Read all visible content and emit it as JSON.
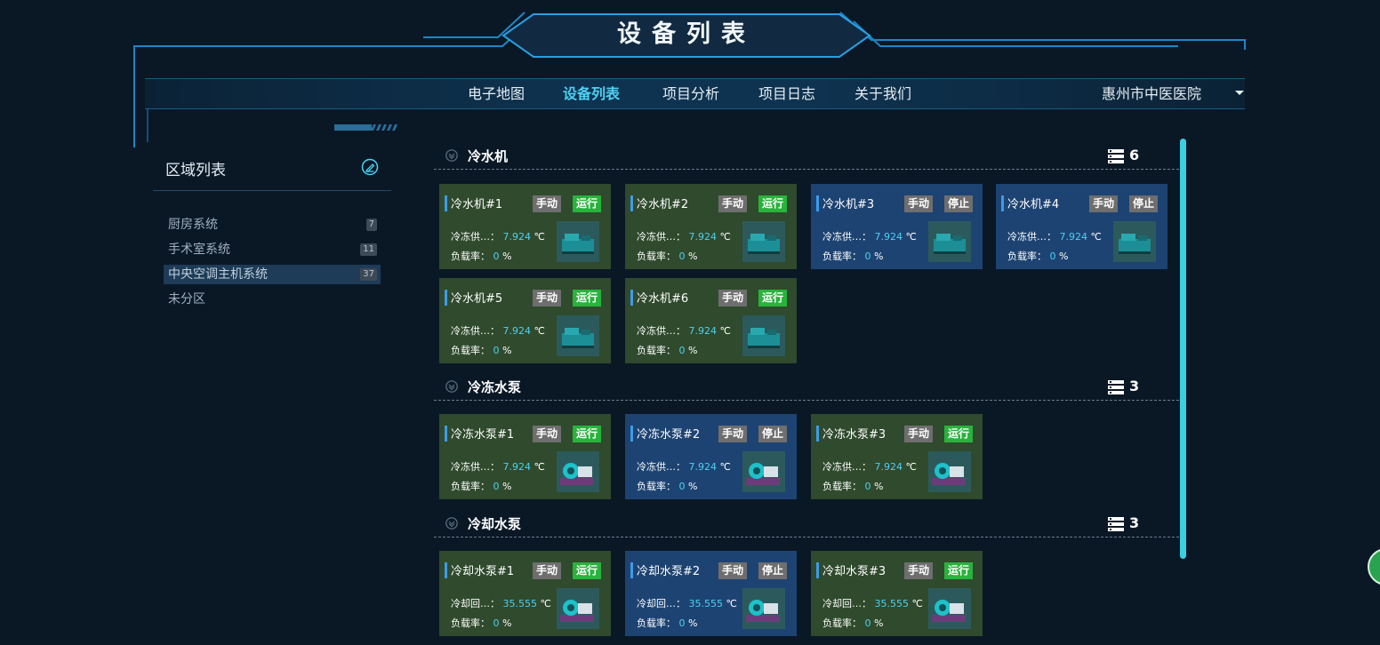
{
  "header": {
    "title": "设备列表"
  },
  "nav": {
    "items": [
      {
        "label": "电子地图",
        "active": false
      },
      {
        "label": "设备列表",
        "active": true
      },
      {
        "label": "项目分析",
        "active": false
      },
      {
        "label": "项目日志",
        "active": false
      },
      {
        "label": "关于我们",
        "active": false
      }
    ],
    "hospital": "惠州市中医医院"
  },
  "sidebar": {
    "title": "区域列表",
    "items": [
      {
        "label": "厨房系统",
        "count": "7",
        "selected": false
      },
      {
        "label": "手术室系统",
        "count": "11",
        "selected": false
      },
      {
        "label": "中央空调主机系统",
        "count": "37",
        "selected": true
      },
      {
        "label": "未分区",
        "count": "",
        "selected": false
      }
    ]
  },
  "sections": [
    {
      "title": "冷水机",
      "count": "6",
      "devices": [
        {
          "name": "冷水机#1",
          "mode": "手动",
          "status": "运行",
          "line1_label": "冷冻供…：",
          "line1_value": "7.924",
          "line1_unit": "℃",
          "line2_label": "负载率：",
          "line2_value": "0",
          "line2_unit": "%",
          "icon": "chiller-icon"
        },
        {
          "name": "冷水机#2",
          "mode": "手动",
          "status": "运行",
          "line1_label": "冷冻供…：",
          "line1_value": "7.924",
          "line1_unit": "℃",
          "line2_label": "负载率：",
          "line2_value": "0",
          "line2_unit": "%",
          "icon": "chiller-icon"
        },
        {
          "name": "冷水机#3",
          "mode": "手动",
          "status": "停止",
          "line1_label": "冷冻供…：",
          "line1_value": "7.924",
          "line1_unit": "℃",
          "line2_label": "负载率：",
          "line2_value": "0",
          "line2_unit": "%",
          "icon": "chiller-icon"
        },
        {
          "name": "冷水机#4",
          "mode": "手动",
          "status": "停止",
          "line1_label": "冷冻供…：",
          "line1_value": "7.924",
          "line1_unit": "℃",
          "line2_label": "负载率：",
          "line2_value": "0",
          "line2_unit": "%",
          "icon": "chiller-icon"
        },
        {
          "name": "冷水机#5",
          "mode": "手动",
          "status": "运行",
          "line1_label": "冷冻供…：",
          "line1_value": "7.924",
          "line1_unit": "℃",
          "line2_label": "负载率：",
          "line2_value": "0",
          "line2_unit": "%",
          "icon": "chiller-icon"
        },
        {
          "name": "冷水机#6",
          "mode": "手动",
          "status": "运行",
          "line1_label": "冷冻供…：",
          "line1_value": "7.924",
          "line1_unit": "℃",
          "line2_label": "负载率：",
          "line2_value": "0",
          "line2_unit": "%",
          "icon": "chiller-icon"
        }
      ]
    },
    {
      "title": "冷冻水泵",
      "count": "3",
      "devices": [
        {
          "name": "冷冻水泵#1",
          "mode": "手动",
          "status": "运行",
          "line1_label": "冷冻供…：",
          "line1_value": "7.924",
          "line1_unit": "℃",
          "line2_label": "负载率：",
          "line2_value": "0",
          "line2_unit": "%",
          "icon": "pump-icon"
        },
        {
          "name": "冷冻水泵#2",
          "mode": "手动",
          "status": "停止",
          "line1_label": "冷冻供…：",
          "line1_value": "7.924",
          "line1_unit": "℃",
          "line2_label": "负载率：",
          "line2_value": "0",
          "line2_unit": "%",
          "icon": "pump-icon"
        },
        {
          "name": "冷冻水泵#3",
          "mode": "手动",
          "status": "运行",
          "line1_label": "冷冻供…：",
          "line1_value": "7.924",
          "line1_unit": "℃",
          "line2_label": "负载率：",
          "line2_value": "0",
          "line2_unit": "%",
          "icon": "pump-icon"
        }
      ]
    },
    {
      "title": "冷却水泵",
      "count": "3",
      "devices": [
        {
          "name": "冷却水泵#1",
          "mode": "手动",
          "status": "运行",
          "line1_label": "冷却回…：",
          "line1_value": "35.555",
          "line1_unit": "℃",
          "line2_label": "负载率：",
          "line2_value": "0",
          "line2_unit": "%",
          "icon": "pump-icon"
        },
        {
          "name": "冷却水泵#2",
          "mode": "手动",
          "status": "停止",
          "line1_label": "冷却回…：",
          "line1_value": "35.555",
          "line1_unit": "℃",
          "line2_label": "负载率：",
          "line2_value": "0",
          "line2_unit": "%",
          "icon": "pump-icon"
        },
        {
          "name": "冷却水泵#3",
          "mode": "手动",
          "status": "运行",
          "line1_label": "冷却回…：",
          "line1_value": "35.555",
          "line1_unit": "℃",
          "line2_label": "负载率：",
          "line2_value": "0",
          "line2_unit": "%",
          "icon": "pump-icon"
        }
      ]
    }
  ],
  "colors": {
    "run": "#28b33c",
    "stop_badge": "#6e6e6e",
    "run_card": "#2f4a2c",
    "stop_card": "#1d4372",
    "accent": "#4fd0f3"
  }
}
